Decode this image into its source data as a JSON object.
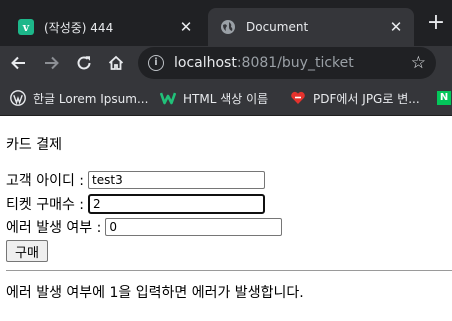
{
  "browser": {
    "tabs": [
      {
        "title": "(작성중) 444",
        "favicon": "velog-v-icon",
        "favicon_letter": "v",
        "active": false
      },
      {
        "title": "Document",
        "favicon": "globe-icon",
        "active": true
      }
    ],
    "new_tab": "+",
    "address": {
      "host": "localhost",
      "rest": ":8081/buy_ticket"
    },
    "bookmarks": [
      {
        "label": "한글 Lorem Ipsum...",
        "icon": "wordpress-icon"
      },
      {
        "label": "HTML 색상 이름",
        "icon": "w-logo-icon"
      },
      {
        "label": "PDF에서 JPG로 변...",
        "icon": "heart-icon"
      },
      {
        "label": "",
        "icon": "naver-icon",
        "icon_letter": "N"
      }
    ]
  },
  "page": {
    "heading": "카드 결제",
    "form": {
      "customer_id_label": "고객 아이디 :",
      "customer_id_value": "test3",
      "ticket_count_label": "티켓 구매수 :",
      "ticket_count_value": "2",
      "error_flag_label": "에러 발생 여부 :",
      "error_flag_value": "0",
      "submit_label": "구매"
    },
    "notice": "에러 발생 여부에 1을 입력하면 에러가 발생합니다."
  },
  "colors": {
    "tab_strip": "#202124",
    "toolbar": "#35363a",
    "velog_green": "#1db78a",
    "naver_green": "#03c75a"
  }
}
